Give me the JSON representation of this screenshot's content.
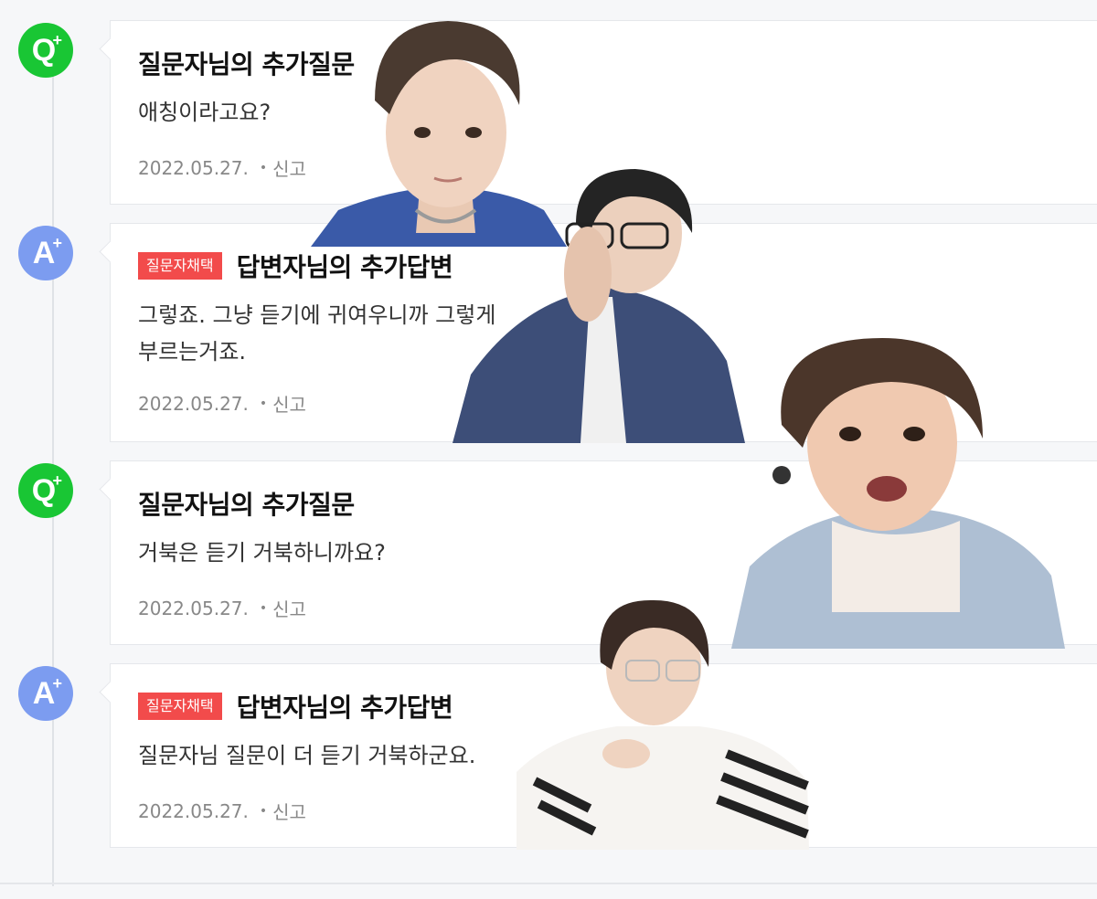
{
  "entries": [
    {
      "marker": "Q",
      "badge": "",
      "title": "질문자님의 추가질문",
      "body": "애칭이라고요?",
      "date": "2022.05.27.",
      "report": "신고"
    },
    {
      "marker": "A",
      "badge": "질문자채택",
      "title": "답변자님의 추가답변",
      "body": "그렇죠. 그냥 듣기에 귀여우니까 그렇게\n부르는거죠.",
      "date": "2022.05.27.",
      "report": "신고"
    },
    {
      "marker": "Q",
      "badge": "",
      "title": "질문자님의 추가질문",
      "body": "거북은 듣기 거북하니까요?",
      "date": "2022.05.27.",
      "report": "신고"
    },
    {
      "marker": "A",
      "badge": "질문자채택",
      "title": "답변자님의 추가답변",
      "body": "질문자님 질문이 더 듣기 거북하군요.",
      "date": "2022.05.27.",
      "report": "신고"
    }
  ],
  "colors": {
    "question": "#19c634",
    "answer": "#7c9cf0",
    "badge": "#f24b4b"
  }
}
